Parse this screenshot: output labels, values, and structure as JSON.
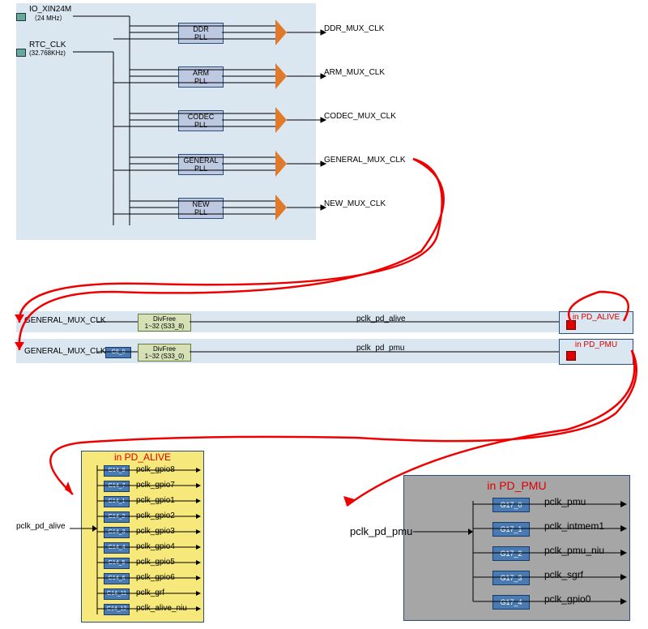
{
  "inputs": [
    {
      "name": "IO_XIN24M",
      "sub": "（24 MHz）"
    },
    {
      "name": "RTC_CLK",
      "sub": "(32.768KHz)"
    }
  ],
  "plls": [
    {
      "label": "DDR\nPLL",
      "out": "DDR_MUX_CLK"
    },
    {
      "label": "ARM\nPLL",
      "out": "ARM_MUX_CLK"
    },
    {
      "label": "CODEC\nPLL",
      "out": "CODEC_MUX_CLK"
    },
    {
      "label": "GENERAL\nPLL",
      "out": "GENERAL_MUX_CLK"
    },
    {
      "label": "NEW\nPLL",
      "out": "NEW_MUX_CLK"
    }
  ],
  "mid": {
    "row1": {
      "in": "GENERAL_MUX_CLK",
      "div": "DivFree\n1~32 (S33_8)",
      "out": "pclk_pd_alive",
      "dest": "in PD_ALIVE"
    },
    "row2": {
      "in": "GENERAL_MUX_CLK",
      "gate": "G8_0",
      "div": "DivFree\n1~32 (S33_0)",
      "out": "pclk_pd_pmu",
      "dest": "in PD_PMU"
    }
  },
  "pd_alive": {
    "title": "in PD_ALIVE",
    "in": "pclk_pd_alive",
    "items": [
      {
        "g": "G14_8",
        "s": "pclk_gpio8"
      },
      {
        "g": "G14_7",
        "s": "pclk_gpio7"
      },
      {
        "g": "G14_1",
        "s": "pclk_gpio1"
      },
      {
        "g": "G14_2",
        "s": "pclk_gpio2"
      },
      {
        "g": "G14_3",
        "s": "pclk_gpio3"
      },
      {
        "g": "G14_4",
        "s": "pclk_gpio4"
      },
      {
        "g": "G14_5",
        "s": "pclk_gpio5"
      },
      {
        "g": "G14_6",
        "s": "pclk_gpio6"
      },
      {
        "g": "G14_11",
        "s": "pclk_grf"
      },
      {
        "g": "G14_12",
        "s": "pclk_alive_niu"
      }
    ]
  },
  "pd_pmu": {
    "title": "in PD_PMU",
    "in": "pclk_pd_pmu",
    "items": [
      {
        "g": "G17_0",
        "s": "pclk_pmu"
      },
      {
        "g": "G17_1",
        "s": "pclk_intmem1"
      },
      {
        "g": "G17_2",
        "s": "pclk_pmu_niu"
      },
      {
        "g": "G17_3",
        "s": "pclk_sgrf"
      },
      {
        "g": "G17_4",
        "s": "pclk_gpio0"
      }
    ]
  }
}
